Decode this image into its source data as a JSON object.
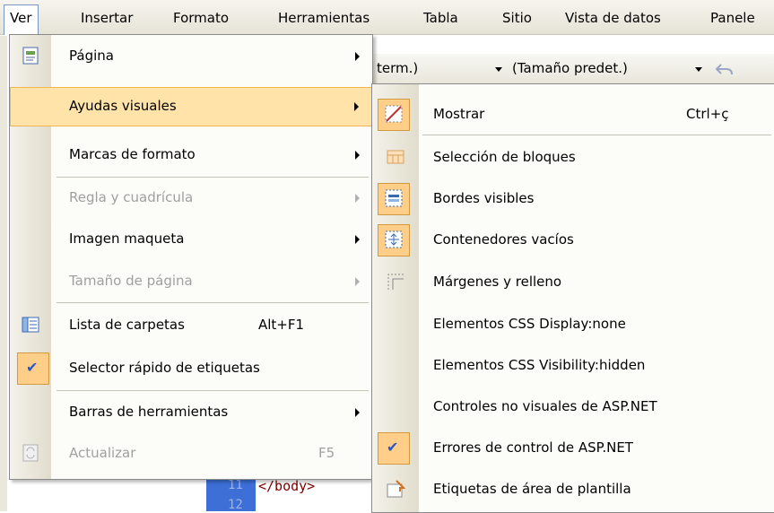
{
  "menubar": {
    "items": [
      "Ver",
      "Insertar",
      "Formato",
      "Herramientas",
      "Tabla",
      "Sitio",
      "Vista de datos",
      "Panele"
    ]
  },
  "toolbar": {
    "font_fragment": "term.)",
    "size_combo": "(Tamaño predet.)"
  },
  "editor": {
    "line_11": "11",
    "line_12": "12",
    "code": "</body>"
  },
  "ver_menu": {
    "items": [
      {
        "label": "Página",
        "submenu": true,
        "enabled": true,
        "icon": "page-icon"
      },
      {
        "label": "Ayudas visuales",
        "submenu": true,
        "enabled": true,
        "highlighted": true
      },
      {
        "label": "Marcas de formato",
        "submenu": true,
        "enabled": true
      },
      {
        "label": "Regla y cuadrícula",
        "submenu": true,
        "enabled": false
      },
      {
        "label": "Imagen maqueta",
        "submenu": true,
        "enabled": true
      },
      {
        "label": "Tamaño de página",
        "submenu": true,
        "enabled": false
      },
      {
        "label": "Lista de carpetas",
        "shortcut": "Alt+F1",
        "enabled": true,
        "icon": "folder-list-icon"
      },
      {
        "label": "Selector rápido de etiquetas",
        "enabled": true,
        "checked": true
      },
      {
        "label": "Barras de herramientas",
        "submenu": true,
        "enabled": true
      },
      {
        "label": "Actualizar",
        "shortcut": "F5",
        "enabled": false,
        "icon": "refresh-icon"
      }
    ]
  },
  "ayudas_submenu": {
    "items": [
      {
        "label": "Mostrar",
        "shortcut": "Ctrl+ç",
        "icon": "show-visual-aids-icon",
        "active": true
      },
      {
        "label": "Selección de bloques",
        "icon": "block-selection-icon",
        "active": false
      },
      {
        "label": "Bordes visibles",
        "icon": "visible-borders-icon",
        "active": true
      },
      {
        "label": "Contenedores vacíos",
        "icon": "empty-containers-icon",
        "active": true
      },
      {
        "label": "Márgenes y relleno",
        "icon": "margins-padding-icon",
        "active": false
      },
      {
        "label": "Elementos CSS Display:none"
      },
      {
        "label": "Elementos CSS Visibility:hidden"
      },
      {
        "label": "Controles no visuales de ASP.NET"
      },
      {
        "label": "Errores de control de ASP.NET",
        "checked": true
      },
      {
        "label": "Etiquetas de área de plantilla",
        "icon": "template-region-labels-icon"
      }
    ]
  },
  "colors": {
    "highlight": "#ffe3a8",
    "highlight_border": "#f0b450",
    "check": "#2a56c8"
  }
}
